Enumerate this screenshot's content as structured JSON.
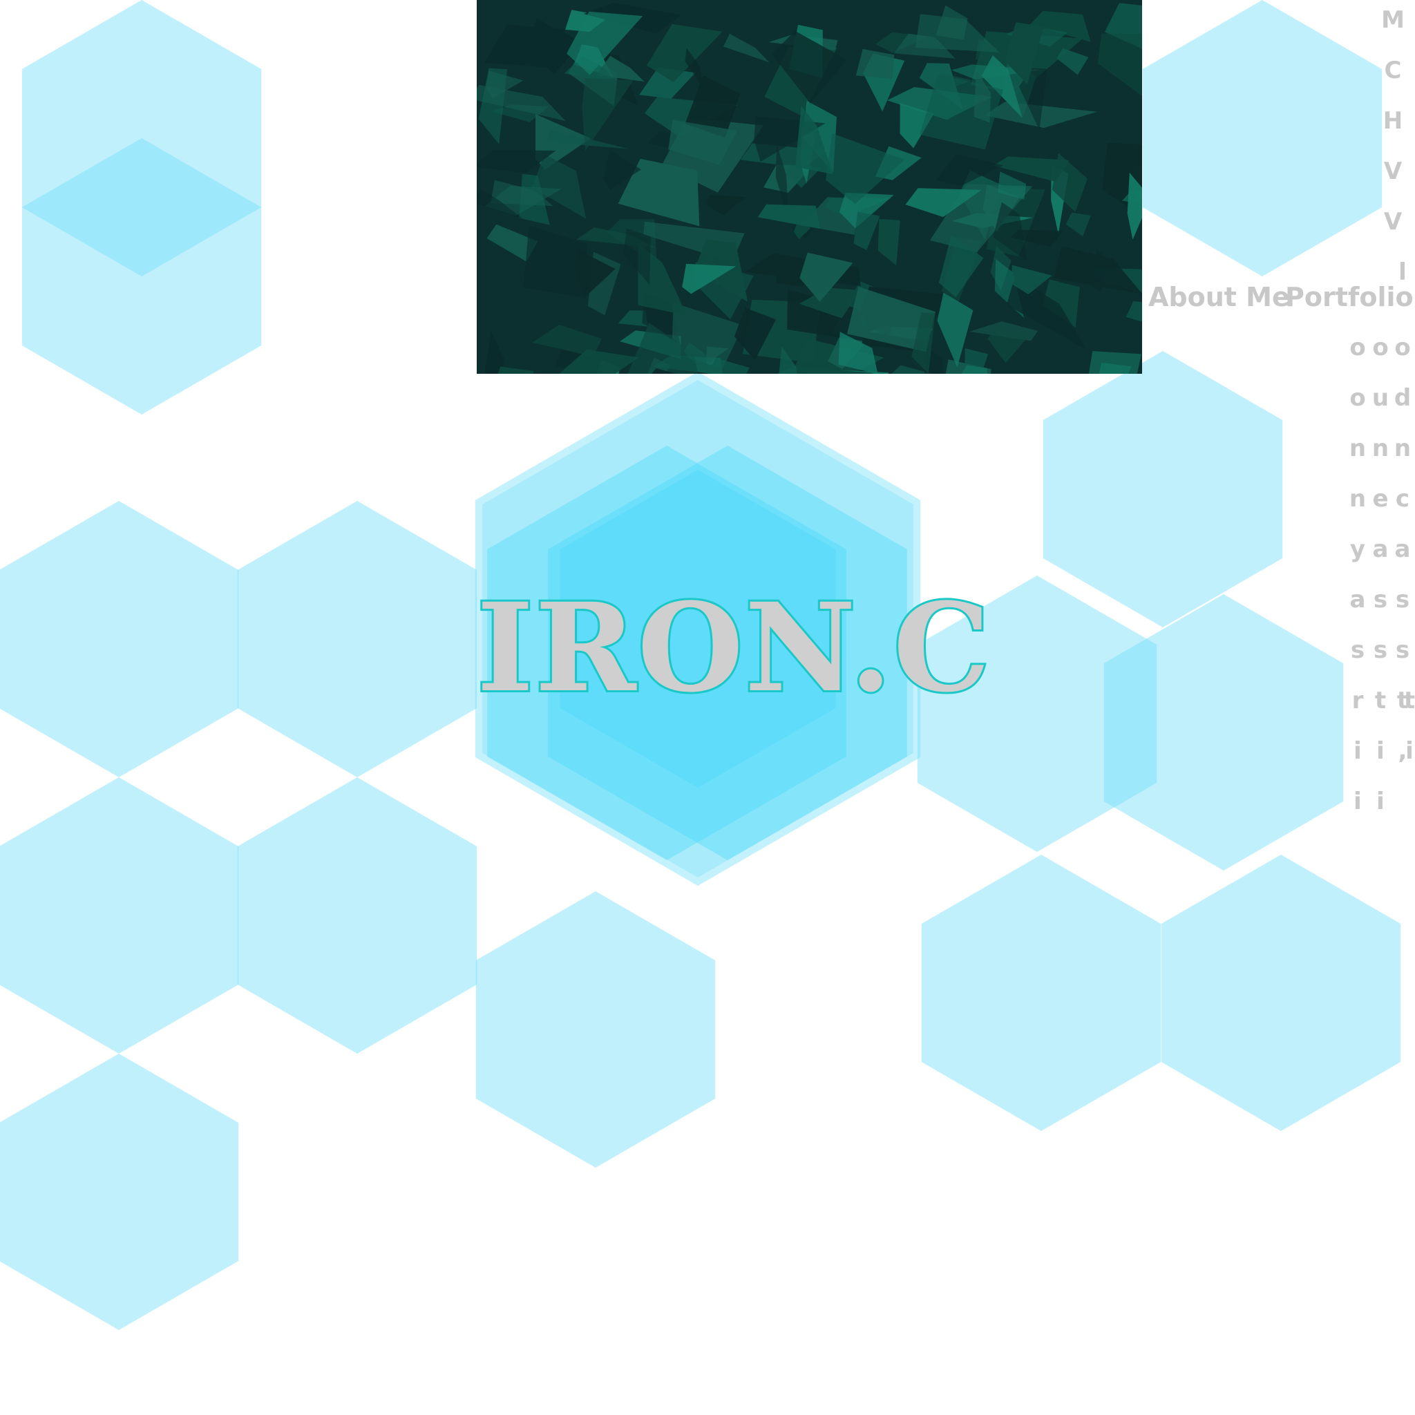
{
  "brand": {
    "title": "IRON.C"
  },
  "nav": {
    "about_label": "About Me",
    "portfolio_label": "Portfolio"
  },
  "vertical_menu": {
    "top_column": [
      "M",
      "C",
      "H",
      "V",
      "V",
      "l"
    ],
    "columns": [
      [
        "o",
        "o",
        "n",
        "n",
        "y",
        "a",
        "s",
        "r",
        "i",
        "i"
      ],
      [
        "o",
        "u",
        "n",
        "e",
        "a",
        "s",
        "s",
        "t",
        "i",
        "i"
      ],
      [
        "o",
        "d",
        "n",
        "c",
        "a",
        "s",
        "s",
        "t",
        ",",
        ""
      ],
      [
        "",
        "",
        "",
        "",
        "",
        "",
        "",
        "t",
        "i",
        ""
      ]
    ]
  },
  "hero_image": {
    "icon": "dark-green-leaf-pattern-image"
  },
  "colors": {
    "hex_fill": "#79dff9",
    "hex_dark": "#3fd8f8",
    "title_text": "#cfcfcf",
    "title_outline": "#1ac8c8",
    "menu_text": "#c8c8c8",
    "hero_dark": "#0b2b2b",
    "hero_mid": "#0f5a4d",
    "hero_light": "#137a66"
  }
}
